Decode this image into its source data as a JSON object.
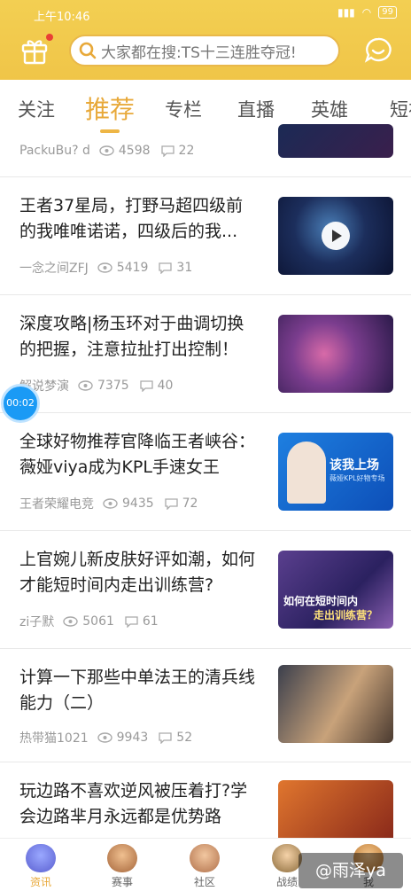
{
  "status_bar": {
    "time": "上午10:46",
    "battery": "99"
  },
  "header": {
    "search_placeholder": "大家都在搜:TS十三连胜夺冠!"
  },
  "tabs": [
    "关注",
    "推荐",
    "专栏",
    "直播",
    "英雄",
    "短视"
  ],
  "active_tab": "推荐",
  "top_row": {
    "author": "PackuBu? d",
    "views": "4598",
    "comments": "22"
  },
  "articles": [
    {
      "title": "王者37星局，打野马超四级前的我唯唯诺诺，四级后的我...",
      "author": "一念之间ZFJ",
      "views": "5419",
      "comments": "31",
      "video": true
    },
    {
      "title": "深度攻略|杨玉环对于曲调切换的把握，注意拉扯打出控制！",
      "author": "解说梦演",
      "views": "7375",
      "comments": "40",
      "video": false
    },
    {
      "title": "全球好物推荐官降临王者峡谷：薇娅viya成为KPL手速女王",
      "author": "王者荣耀电竞",
      "views": "9435",
      "comments": "72",
      "video": false,
      "thumb_text": [
        "该我上场",
        "薇娅KPL好物专场"
      ]
    },
    {
      "title": "上官婉儿新皮肤好评如潮，如何才能短时间内走出训练营?",
      "author": "zi子默",
      "views": "5061",
      "comments": "61",
      "video": false,
      "thumb_text": [
        "如何在短时间内",
        "走出训练营？"
      ]
    },
    {
      "title": "计算一下那些中单法王的清兵线能力（二）",
      "author": "热带猫1021",
      "views": "9943",
      "comments": "52",
      "video": false
    },
    {
      "title": "玩边路不喜欢逆风被压着打?学会边路芈月永远都是优势路",
      "author": "",
      "views": "",
      "comments": "",
      "video": false
    }
  ],
  "float_timer": "00:02",
  "bottom_nav": [
    "资讯",
    "赛事",
    "社区",
    "战绩",
    "我"
  ],
  "active_nav": "资讯",
  "watermark": "@雨泽ya",
  "colors": {
    "accent": "#e8a93a",
    "header": "#f0c548",
    "timer": "#1a9af5"
  }
}
